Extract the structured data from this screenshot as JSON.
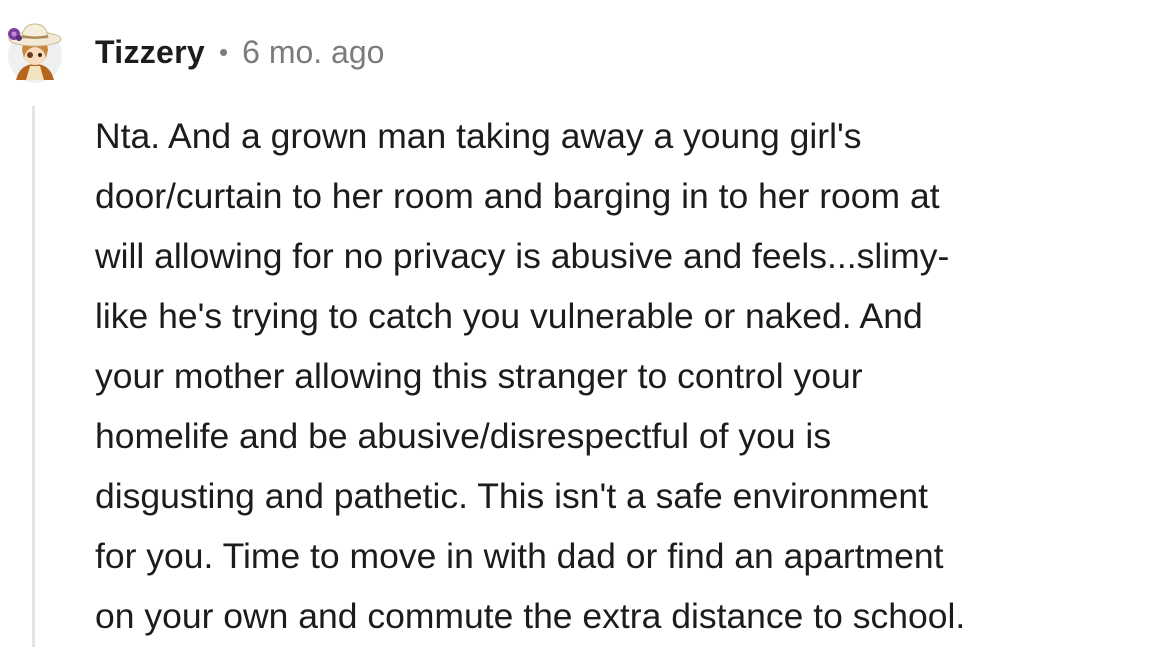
{
  "comment": {
    "username": "Tizzery",
    "separator": "•",
    "timestamp": "6 mo. ago",
    "avatar_icon": "avatar-icon",
    "body_lines": [
      "Nta. And a grown man taking away a young girl's",
      "door/curtain to her room and barging in to her room at",
      "will allowing for no privacy is abusive and feels...slimy-",
      "like he's trying to catch you vulnerable or naked. And",
      "your mother allowing this stranger to control your",
      "homelife and be abusive/disrespectful of you is",
      "disgusting and pathetic. This isn't a safe environment",
      "for you. Time to move in with dad or find an apartment",
      "on your own and commute the extra distance to school."
    ]
  }
}
